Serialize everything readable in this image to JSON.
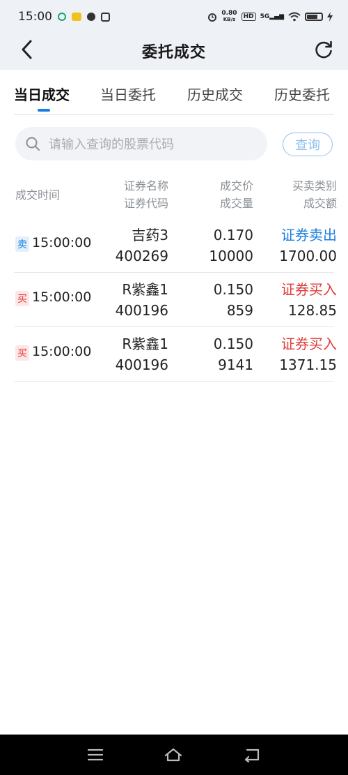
{
  "status_bar": {
    "time": "15:00",
    "net_speed_value": "0.80",
    "net_speed_unit": "KB/s",
    "hd_label": "HD",
    "signal_label": "5G"
  },
  "header": {
    "title": "委托成交"
  },
  "tabs": [
    {
      "label": "当日成交",
      "active": true
    },
    {
      "label": "当日委托",
      "active": false
    },
    {
      "label": "历史成交",
      "active": false
    },
    {
      "label": "历史委托",
      "active": false
    }
  ],
  "search": {
    "placeholder": "请输入查询的股票代码",
    "button_label": "查询"
  },
  "columns": {
    "time": "成交时间",
    "name": "证券名称",
    "code": "证券代码",
    "price": "成交价",
    "volume": "成交量",
    "type": "买卖类别",
    "amount": "成交额"
  },
  "rows": [
    {
      "badge": "卖",
      "side": "sell",
      "time": "15:00:00",
      "name": "吉药3",
      "code": "400269",
      "price": "0.170",
      "volume": "10000",
      "type": "证券卖出",
      "amount": "1700.00"
    },
    {
      "badge": "买",
      "side": "buy",
      "time": "15:00:00",
      "name": "R紫鑫1",
      "code": "400196",
      "price": "0.150",
      "volume": "859",
      "type": "证券买入",
      "amount": "128.85"
    },
    {
      "badge": "买",
      "side": "buy",
      "time": "15:00:00",
      "name": "R紫鑫1",
      "code": "400196",
      "price": "0.150",
      "volume": "9141",
      "type": "证券买入",
      "amount": "1371.15"
    }
  ],
  "colors": {
    "accent": "#1a7fe0",
    "sell": "#1a7fe0",
    "buy": "#e23b3b",
    "header_bg": "#eef1f6"
  },
  "icons": {
    "back": "chevron-left-icon",
    "refresh": "refresh-icon",
    "search": "search-icon",
    "nav_menu": "menu-icon",
    "nav_home": "home-icon",
    "nav_back": "back-icon"
  }
}
